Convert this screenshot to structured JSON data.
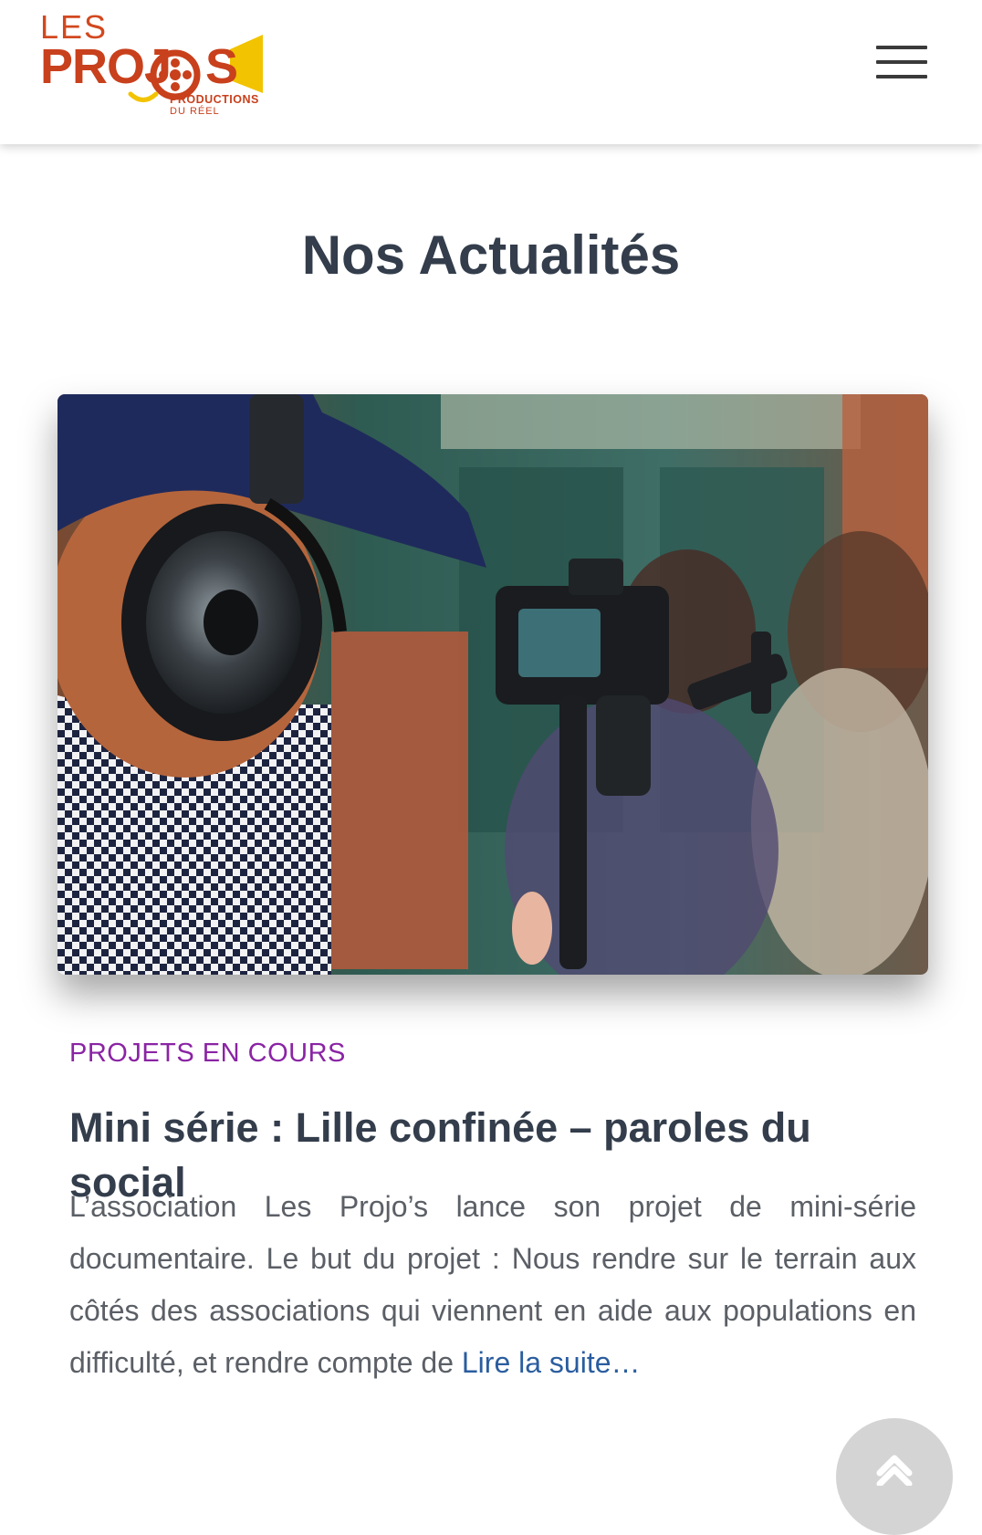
{
  "header": {
    "logo": {
      "les": "LES",
      "projos": "PROJOS",
      "productions": "PRODUCTIONS",
      "du_reel": "DU RÉEL"
    },
    "menu_icon": "hamburger-menu-icon"
  },
  "main": {
    "page_title": "Nos Actualités",
    "post": {
      "category": "PROJETS EN COURS",
      "title": "Mini série : Lille confinée – paroles du social",
      "excerpt": "L’association Les Projo’s lance son projet de mini-série documentaire. Le but du projet : Nous rendre sur le terrain aux côtés des associations qui viennent en aide aux populations en difficulté, et rendre compte de",
      "read_more": "Lire la suite…"
    }
  },
  "scroll_top_icon": "chevron-up-icon",
  "colors": {
    "logo_orange": "#c8401c",
    "logo_yellow": "#f2c300",
    "title": "#333d4b",
    "category": "#8a24a4",
    "link": "#2a5d9f",
    "body_text": "#5b5f66"
  }
}
